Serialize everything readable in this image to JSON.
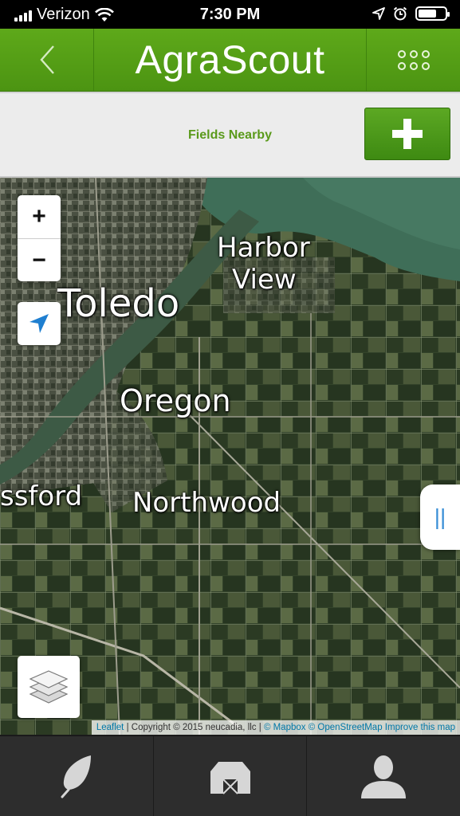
{
  "status_bar": {
    "carrier": "Verizon",
    "time": "7:30 PM"
  },
  "header": {
    "title": "AgraScout",
    "back_icon": "chevron-left-icon",
    "menu_icon": "grid-dots-icon"
  },
  "fields_bar": {
    "label": "Fields Nearby",
    "add_icon": "plus-icon"
  },
  "map": {
    "places": [
      "Harbor",
      "View",
      "Toledo",
      "Oregon",
      "ssford",
      "Northwood"
    ],
    "zoom_in": "+",
    "zoom_out": "−",
    "drawer_handle": "||",
    "attribution": {
      "leaflet": "Leaflet",
      "copyright": "| Copyright © 2015 neucadia, llc |",
      "mapbox": "© Mapbox",
      "osm": "© OpenStreetMap",
      "improve": "Improve this map"
    }
  },
  "tabs": [
    {
      "icon": "leaf-icon"
    },
    {
      "icon": "barn-icon"
    },
    {
      "icon": "user-icon"
    }
  ],
  "colors": {
    "header_green": "#5ea91a",
    "label_green": "#5a9a1b",
    "tabbar": "#2d2d2d",
    "locate_blue": "#1f7fd0"
  }
}
